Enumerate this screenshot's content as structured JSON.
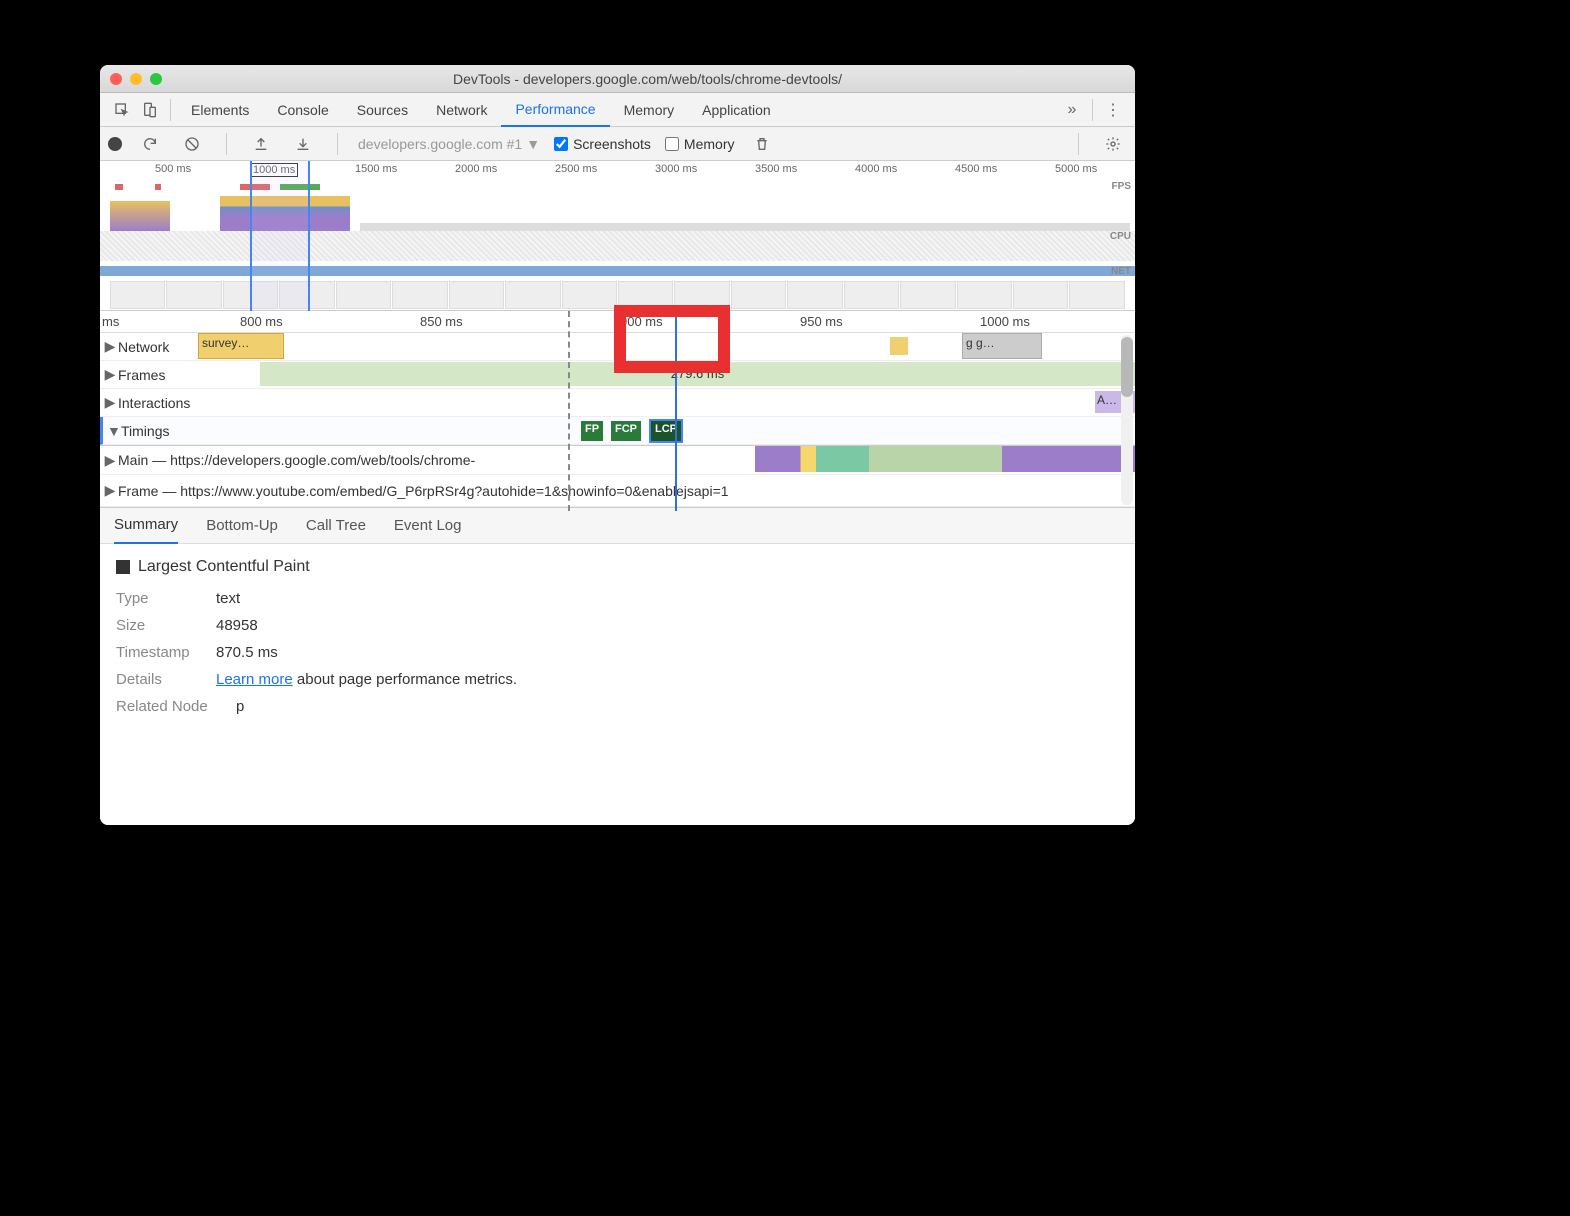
{
  "title": "DevTools - developers.google.com/web/tools/chrome-devtools/",
  "tabs": [
    "Elements",
    "Console",
    "Sources",
    "Network",
    "Performance",
    "Memory",
    "Application"
  ],
  "active_tab": "Performance",
  "toolbar": {
    "dropdown": "developers.google.com #1",
    "screenshots_label": "Screenshots",
    "memory_label": "Memory"
  },
  "overview_ticks": [
    "500 ms",
    "1000 ms",
    "1500 ms",
    "2000 ms",
    "2500 ms",
    "3000 ms",
    "3500 ms",
    "4000 ms",
    "4500 ms",
    "5000 ms"
  ],
  "overview_labels": {
    "fps": "FPS",
    "cpu": "CPU",
    "net": "NET"
  },
  "ruler_ticks": [
    "ms",
    "800 ms",
    "850 ms",
    "900 ms",
    "950 ms",
    "1000 ms"
  ],
  "rows": {
    "network": {
      "label": "Network",
      "item1": "survey…",
      "item2": "g g…"
    },
    "frames": {
      "label": "Frames",
      "duration": "279.6 ms"
    },
    "interactions": {
      "label": "Interactions",
      "item": "A…"
    },
    "timings": {
      "label": "Timings",
      "fp": "FP",
      "fcp": "FCP",
      "lcp": "LCP"
    },
    "main": "Main — https://developers.google.com/web/tools/chrome-",
    "frame": "Frame — https://www.youtube.com/embed/G_P6rpRSr4g?autohide=1&showinfo=0&enablejsapi=1"
  },
  "bottom_tabs": [
    "Summary",
    "Bottom-Up",
    "Call Tree",
    "Event Log"
  ],
  "active_bottom_tab": "Summary",
  "summary": {
    "title": "Largest Contentful Paint",
    "type_k": "Type",
    "type_v": "text",
    "size_k": "Size",
    "size_v": "48958",
    "ts_k": "Timestamp",
    "ts_v": "870.5 ms",
    "details_k": "Details",
    "learn": "Learn more",
    "details_rest": " about page performance metrics.",
    "rn_k": "Related Node",
    "rn_v": "p"
  }
}
